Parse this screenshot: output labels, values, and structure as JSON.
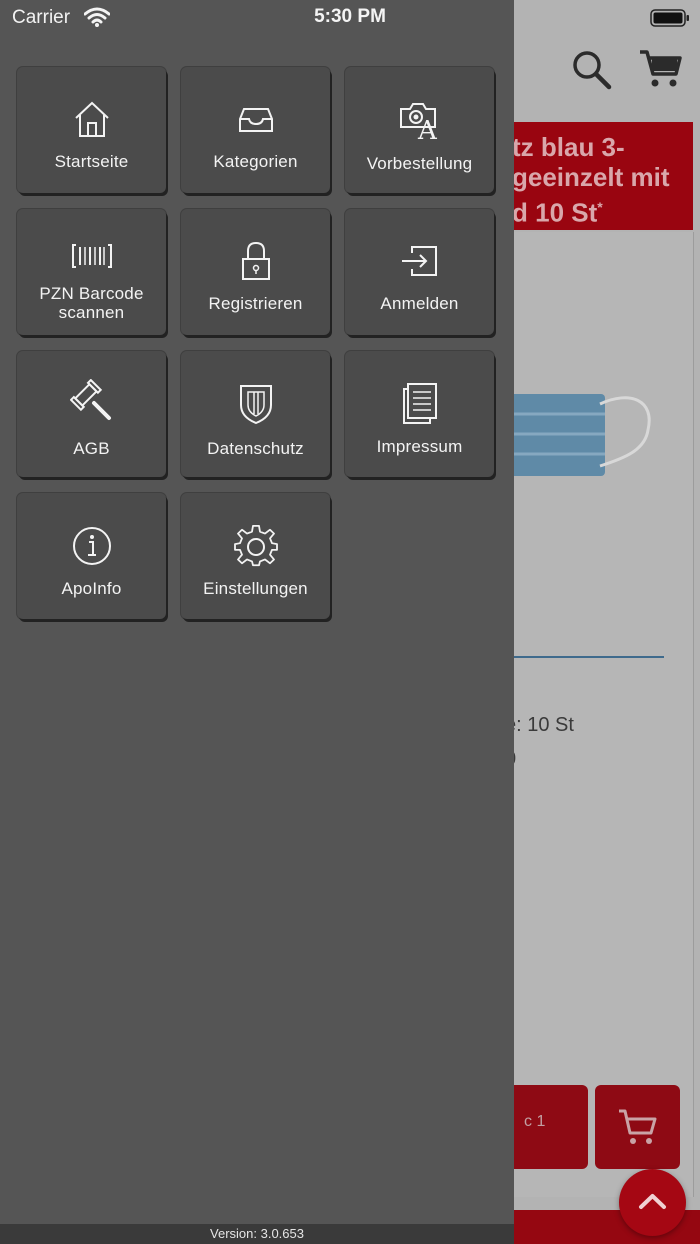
{
  "status_bar": {
    "carrier": "Carrier",
    "time": "5:30 PM"
  },
  "background": {
    "banner_lines": [
      "tz blau 3-",
      "geeinzelt mit",
      "d 10 St"
    ],
    "banner_sup": "*",
    "text_line1": "e: 10 St",
    "text_line2": "0",
    "button_text": "c 1",
    "accent": "#990510"
  },
  "menu": {
    "items": [
      {
        "label": "Startseite",
        "icon": "home-icon"
      },
      {
        "label": "Kategorien",
        "icon": "inbox-icon"
      },
      {
        "label": "Vorbestellung",
        "icon": "camera-prescription-icon"
      },
      {
        "label": "PZN Barcode scannen",
        "icon": "barcode-scan-icon"
      },
      {
        "label": "Registrieren",
        "icon": "lock-icon"
      },
      {
        "label": "Anmelden",
        "icon": "login-icon"
      },
      {
        "label": "AGB",
        "icon": "gavel-icon"
      },
      {
        "label": "Datenschutz",
        "icon": "shield-icon"
      },
      {
        "label": "Impressum",
        "icon": "document-icon"
      },
      {
        "label": "ApoInfo",
        "icon": "info-icon"
      },
      {
        "label": "Einstellungen",
        "icon": "gear-icon"
      }
    ],
    "version": "Version: 3.0.653"
  }
}
